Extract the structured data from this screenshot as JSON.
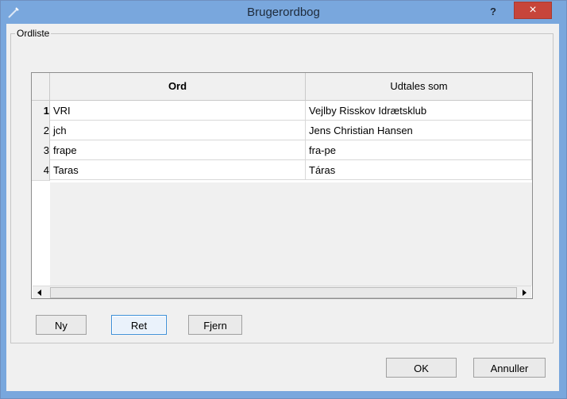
{
  "window": {
    "title": "Brugerordbog",
    "help_glyph": "?",
    "close_glyph": "×",
    "accent": "#79a7dd",
    "close_color": "#c7453a"
  },
  "group": {
    "title": "Ordliste"
  },
  "table": {
    "columns": [
      "Ord",
      "Udtales som"
    ],
    "rows": [
      {
        "num": "1",
        "word": "VRI",
        "pron": "Vejlby Risskov Idrætsklub"
      },
      {
        "num": "2",
        "word": "jch",
        "pron": "Jens Christian Hansen"
      },
      {
        "num": "3",
        "word": "frape",
        "pron": "fra-pe"
      },
      {
        "num": "4",
        "word": "Taras",
        "pron": "Táras"
      }
    ]
  },
  "buttons": {
    "new": "Ny",
    "edit": "Ret",
    "remove": "Fjern",
    "ok": "OK",
    "cancel": "Annuller"
  }
}
